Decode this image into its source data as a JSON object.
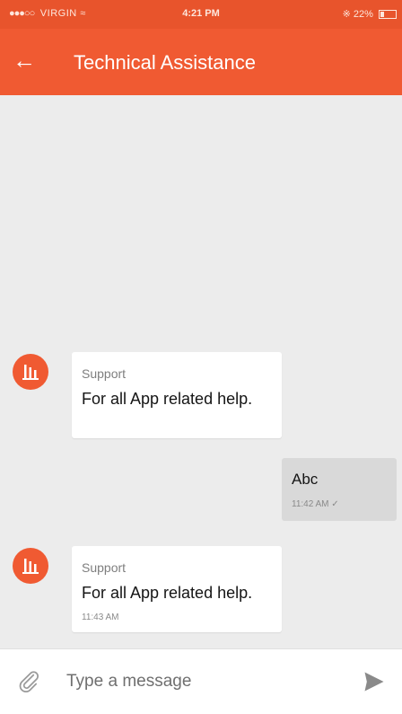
{
  "status_bar": {
    "carrier": "VIRGIN",
    "time": "4:21 PM",
    "battery": "22%"
  },
  "app_bar": {
    "title": "Technical Assistance"
  },
  "messages": [
    {
      "direction": "incoming",
      "sender": "Support",
      "text": "For all App related help.",
      "time": ""
    },
    {
      "direction": "outgoing",
      "text": "Abc",
      "time": "11:42 AM"
    },
    {
      "direction": "incoming",
      "sender": "Support",
      "text": "For all App related help.",
      "time": "11:43 AM"
    }
  ],
  "composer": {
    "placeholder": "Type a message"
  },
  "colors": {
    "brand": "#f05a32",
    "status_bar": "#e8542c",
    "background": "#ececec",
    "outgoing_bubble": "#d9d9d9"
  },
  "icons": {
    "back": "arrow-left-icon",
    "wifi": "wifi-icon",
    "battery": "battery-icon",
    "avatar": "support-logo-icon",
    "attach": "paperclip-icon",
    "send": "send-icon",
    "read_receipt": "check-icon"
  }
}
